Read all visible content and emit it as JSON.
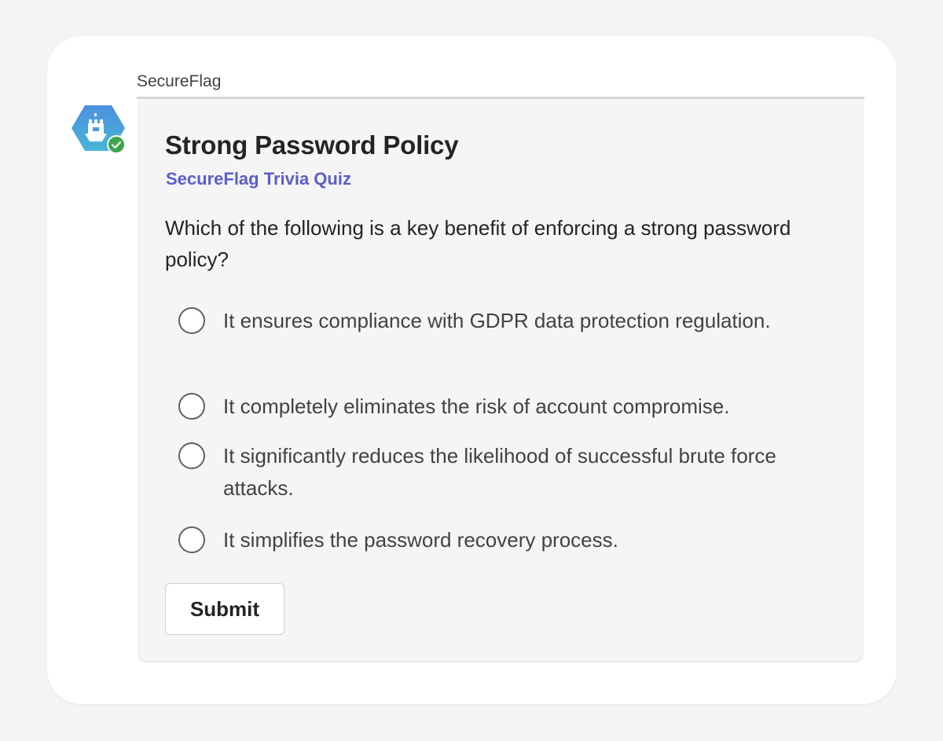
{
  "message": {
    "sender": "SecureFlag",
    "avatar_icon": "secureflag-castle-icon",
    "presence_icon": "presence-available-check-icon",
    "colors": {
      "avatar_gradient_top": "#4d8fe0",
      "avatar_gradient_bottom": "#47b6d6",
      "presence": "#3ea64a",
      "subtitle": "#5b5fc7"
    }
  },
  "card": {
    "title": "Strong Password Policy",
    "subtitle": "SecureFlag Trivia Quiz",
    "question": "Which of the following is a key benefit of enforcing a strong password policy?",
    "options": [
      {
        "label": "It ensures compliance with GDPR data protection regulation.",
        "selected": false
      },
      {
        "label": "It completely eliminates the risk of account compromise.",
        "selected": false
      },
      {
        "label": "It significantly reduces the likelihood of successful brute force attacks.",
        "selected": false
      },
      {
        "label": "It simplifies the password recovery process.",
        "selected": false
      }
    ],
    "submit_label": "Submit"
  }
}
